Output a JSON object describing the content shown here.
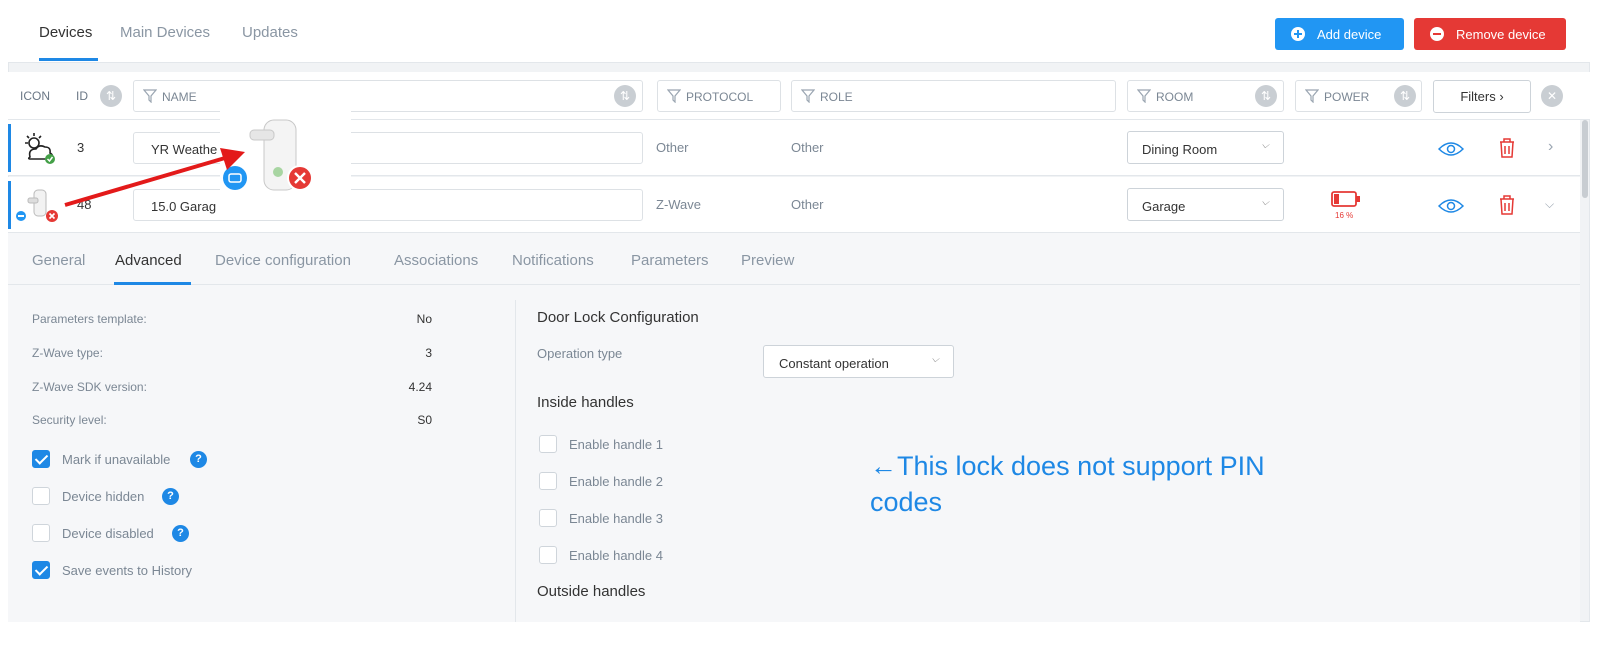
{
  "top_tabs": [
    "Devices",
    "Main Devices",
    "Updates"
  ],
  "actions": {
    "add": "Add device",
    "remove": "Remove device"
  },
  "columns": {
    "icon": "ICON",
    "id": "ID",
    "name": "NAME",
    "protocol": "PROTOCOL",
    "role": "ROLE",
    "room": "ROOM",
    "power": "POWER",
    "filters": "Filters"
  },
  "rows": [
    {
      "id": "3",
      "name": "YR Weathe",
      "protocol": "Other",
      "role": "Other",
      "room": "Dining Room",
      "power": ""
    },
    {
      "id": "48",
      "name": "15.0 Garag",
      "protocol": "Z-Wave",
      "role": "Other",
      "room": "Garage",
      "power": "16 %"
    }
  ],
  "sub_tabs": [
    "General",
    "Advanced",
    "Device configuration",
    "Associations",
    "Notifications",
    "Parameters",
    "Preview"
  ],
  "props": [
    {
      "label": "Parameters template:",
      "value": "No"
    },
    {
      "label": "Z-Wave type:",
      "value": "3"
    },
    {
      "label": "Z-Wave SDK version:",
      "value": "4.24"
    },
    {
      "label": "Security level:",
      "value": "S0"
    }
  ],
  "checks": [
    {
      "label": "Mark if unavailable",
      "checked": true,
      "help": "?"
    },
    {
      "label": "Device hidden",
      "checked": false,
      "help": "?"
    },
    {
      "label": "Device disabled",
      "checked": false,
      "help": "?"
    },
    {
      "label": "Save events to History",
      "checked": true
    }
  ],
  "config": {
    "title": "Door Lock Configuration",
    "op_label": "Operation type",
    "op_value": "Constant operation",
    "inside_title": "Inside handles",
    "handles": [
      "Enable handle 1",
      "Enable handle 2",
      "Enable handle 3",
      "Enable handle 4"
    ],
    "outside_title": "Outside handles"
  },
  "annotation": "←This lock does not  support PIN codes",
  "colors": {
    "accent": "#1e88e5",
    "danger": "#e53935",
    "ok": "#43a047"
  }
}
